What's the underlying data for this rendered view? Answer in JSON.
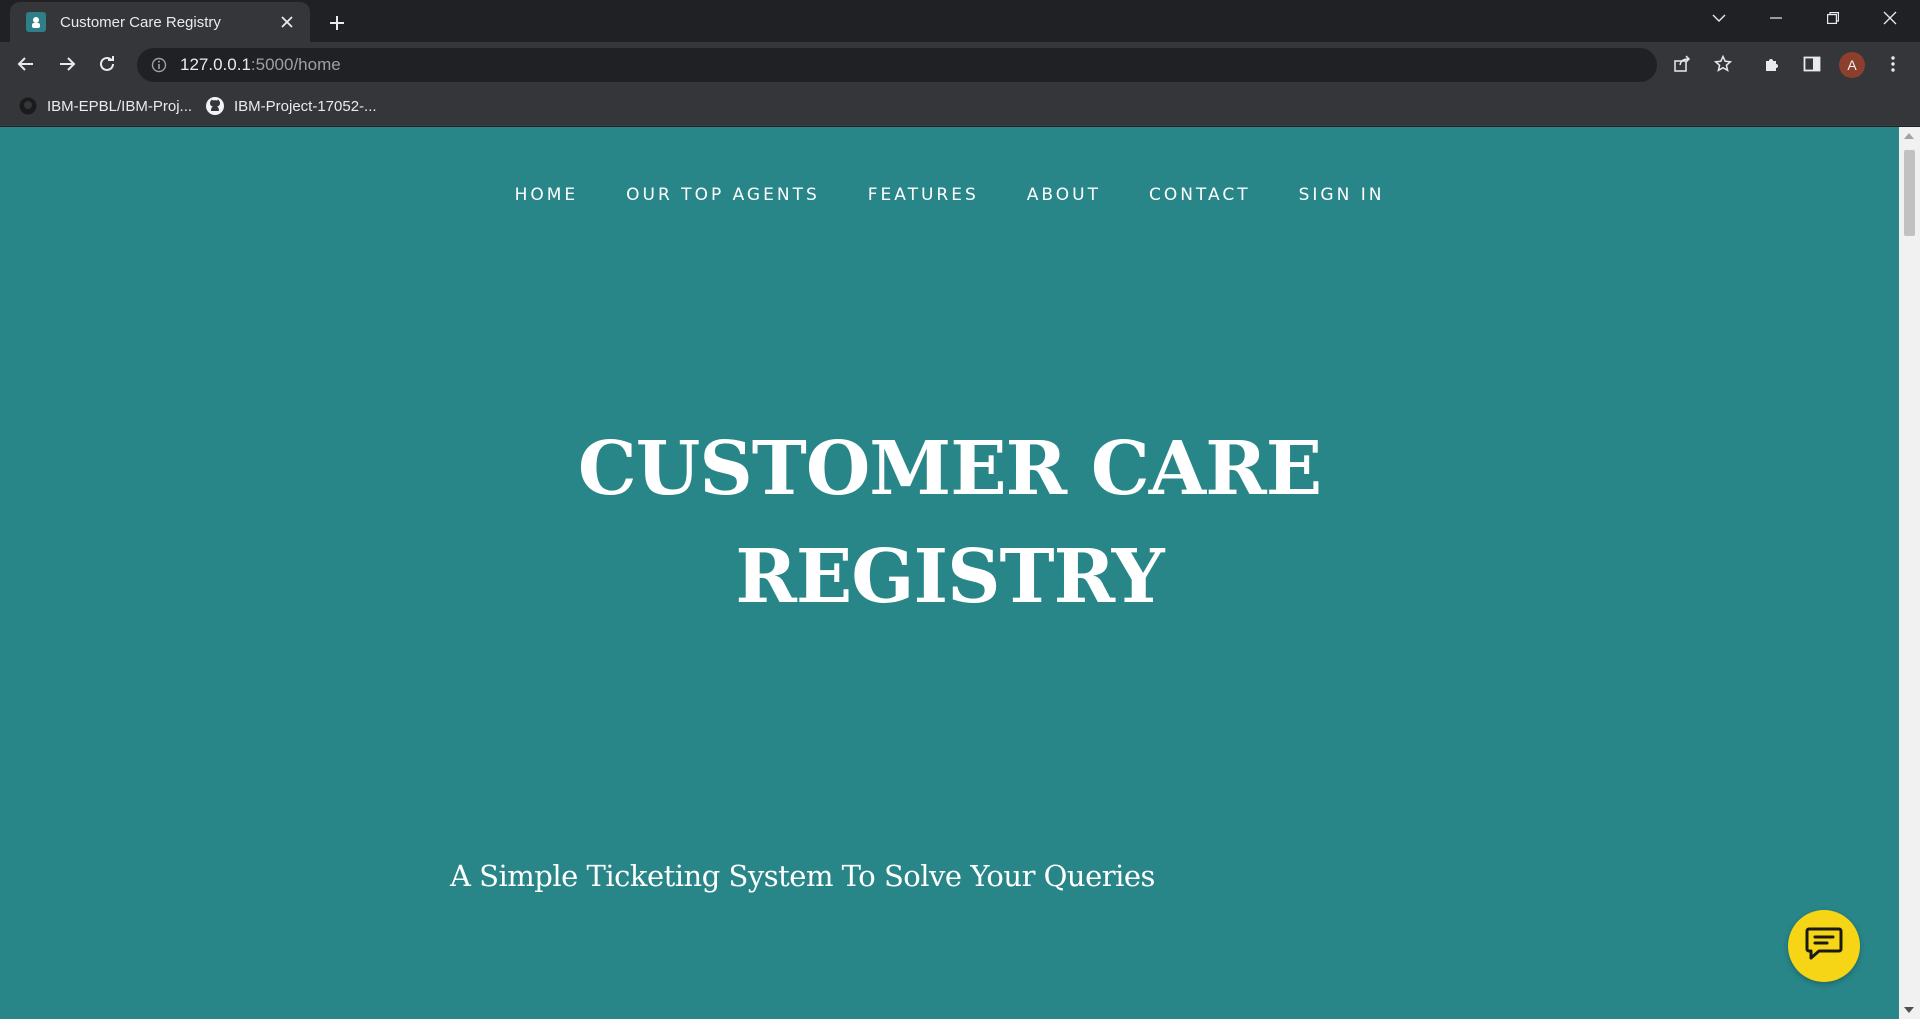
{
  "browser": {
    "tab_title": "Customer Care Registry",
    "url_host": "127.0.0.1",
    "url_path": ":5000/home",
    "profile_initial": "A",
    "bookmarks": [
      {
        "label": "IBM-EPBL/IBM-Proj...",
        "icon": "github-icon"
      },
      {
        "label": "IBM-Project-17052-...",
        "icon": "github-icon"
      }
    ]
  },
  "page": {
    "nav": [
      "HOME",
      "OUR TOP AGENTS",
      "FEATURES",
      "ABOUT",
      "CONTACT",
      "SIGN IN"
    ],
    "title_line1": "CUSTOMER CARE",
    "title_line2": "REGISTRY",
    "tagline": "A Simple Ticketing System To Solve Your Queries"
  },
  "colors": {
    "page_background": "#288689",
    "chat_button": "#f5d516",
    "chrome_dark": "#202124",
    "chrome_toolbar": "#35363a"
  }
}
